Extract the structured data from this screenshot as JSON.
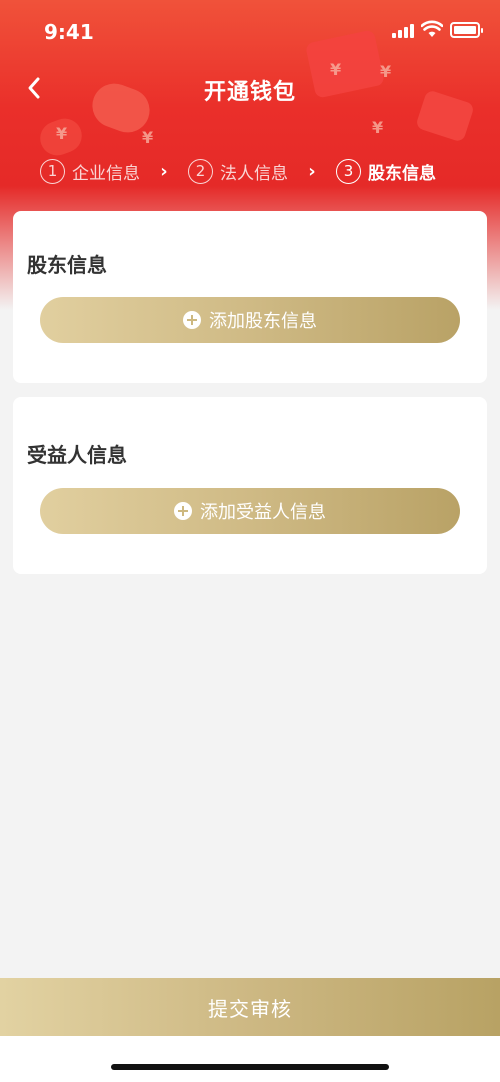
{
  "status_bar": {
    "time": "9:41"
  },
  "nav": {
    "title": "开通钱包",
    "back_icon": "chevron-left-icon"
  },
  "steps": [
    {
      "num": "1",
      "label": "企业信息",
      "active": false
    },
    {
      "num": "2",
      "label": "法人信息",
      "active": false
    },
    {
      "num": "3",
      "label": "股东信息",
      "active": true
    }
  ],
  "shareholder": {
    "title": "股东信息",
    "add_label": "添加股东信息"
  },
  "beneficiary": {
    "title": "受益人信息",
    "add_label": "添加受益人信息"
  },
  "submit": {
    "label": "提交审核"
  },
  "colors": {
    "header_red": "#e52a28",
    "gold_start": "#e1cf9f",
    "gold_end": "#b9a266",
    "background": "#f3f3f3"
  }
}
